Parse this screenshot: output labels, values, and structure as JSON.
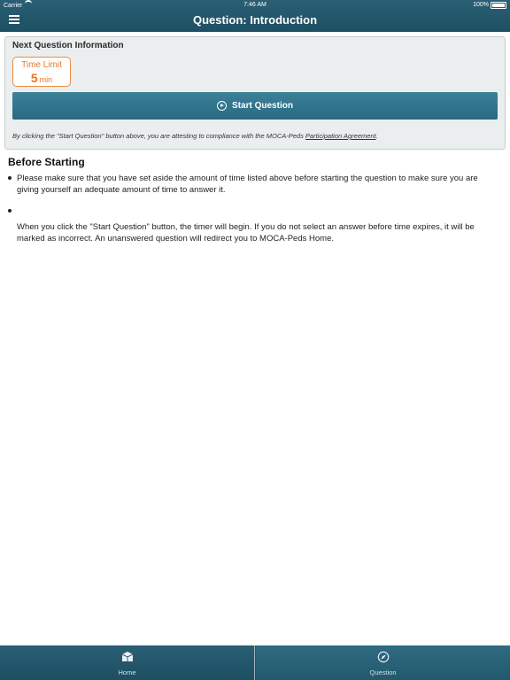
{
  "status_bar": {
    "carrier": "Carrier",
    "time": "7:46 AM",
    "battery": "100%"
  },
  "header": {
    "title": "Question: Introduction"
  },
  "next_question": {
    "title": "Next Question Information",
    "time_limit_label": "Time Limit",
    "time_limit_value": "5",
    "time_limit_unit": "min",
    "start_button_label": "Start Question",
    "attestation_text": "By clicking the \"Start Question\" button above, you are attesting to compliance with the MOCA-Peds ",
    "attestation_link": "Participation Agreement",
    "attestation_end": "."
  },
  "before_starting": {
    "title": "Before Starting",
    "bullet_1": "Please make sure that you have set aside the amount of time listed above before starting the question to make sure you are giving yourself an adequate amount of time to answer it.",
    "paragraph": "When you click the \"Start Question\" button, the timer will begin. If you do not select an answer before time expires, it will be marked as incorrect. An unanswered question will redirect you to MOCA-Peds Home."
  },
  "tab_bar": {
    "home_label": "Home",
    "question_label": "Question"
  },
  "colors": {
    "accent": "#1e4f63",
    "orange": "#e8772a",
    "card_bg": "#eaeeee"
  }
}
